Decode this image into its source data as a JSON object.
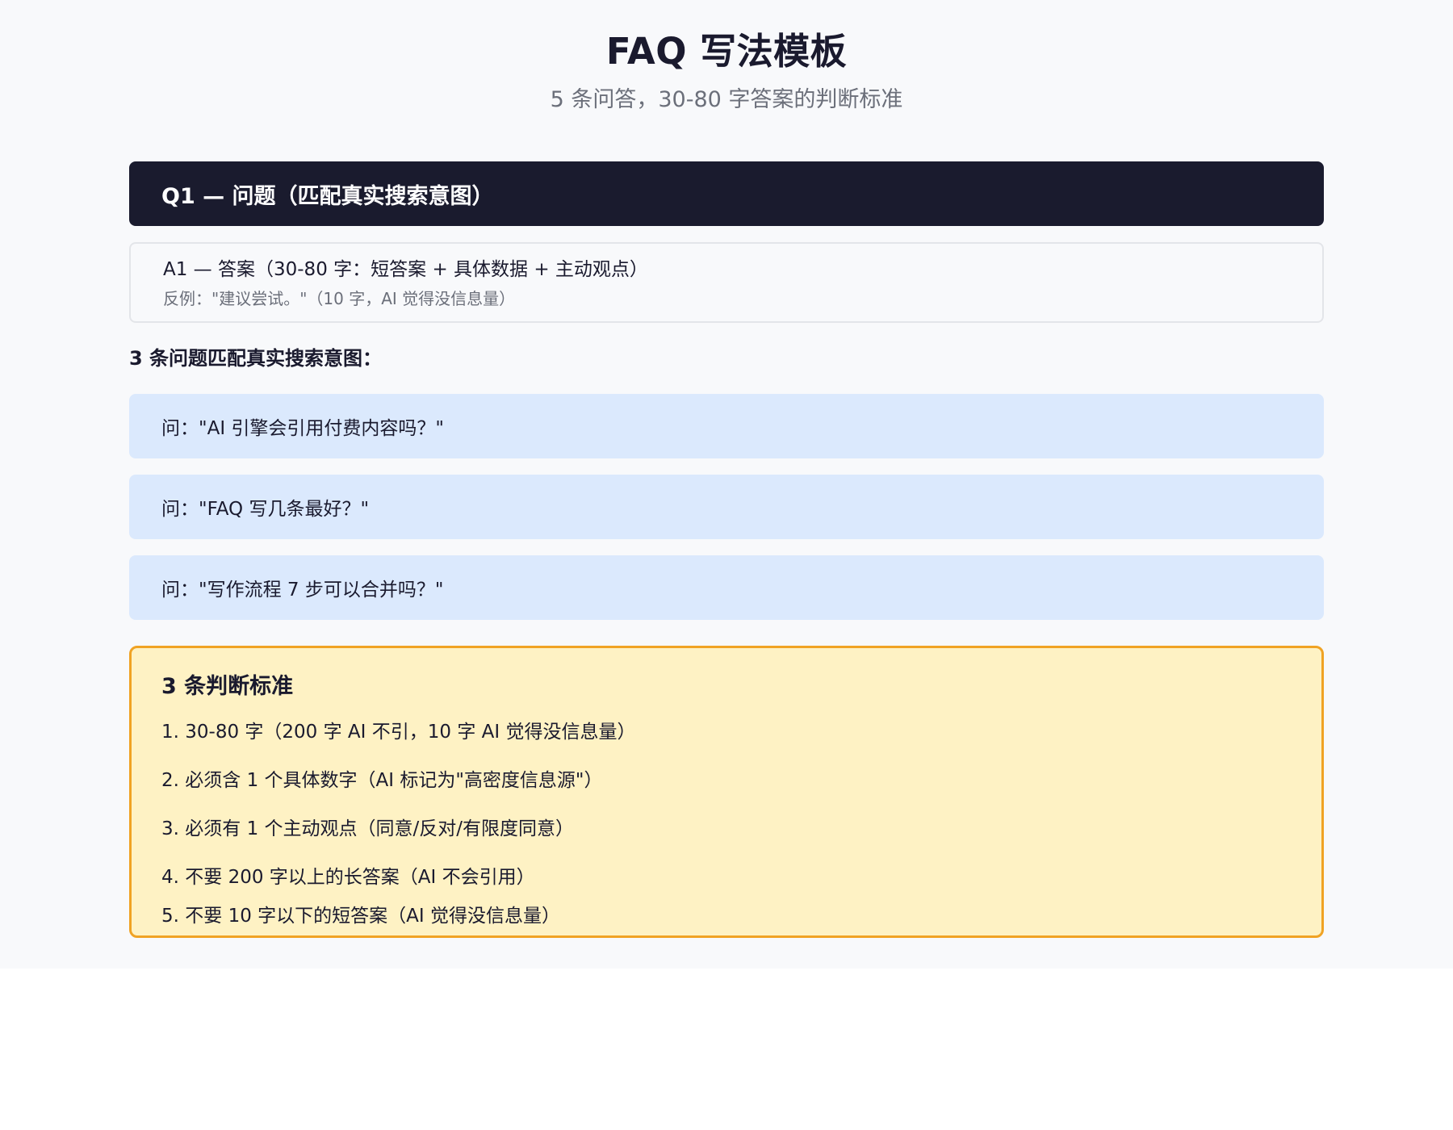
{
  "header": {
    "title": "FAQ 写法模板",
    "subtitle": "5 条问答，30-80 字答案的判断标准"
  },
  "q1": {
    "label": "Q1 — 问题（匹配真实搜索意图）"
  },
  "a1": {
    "label": "A1 — 答案（30-80 字：短答案 + 具体数据 + 主动观点）",
    "counterexample": "反例：\"建议尝试。\"（10 字，AI 觉得没信息量）"
  },
  "questions_section": {
    "heading": "3 条问题匹配真实搜索意图：",
    "items": [
      "问：\"AI 引擎会引用付费内容吗？\"",
      "问：\"FAQ 写几条最好？\"",
      "问：\"写作流程 7 步可以合并吗？\""
    ]
  },
  "criteria": {
    "title": "3 条判断标准",
    "items": [
      "1. 30-80 字（200 字 AI 不引，10 字 AI 觉得没信息量）",
      "2. 必须含 1 个具体数字（AI 标记为\"高密度信息源\"）",
      "3. 必须有 1 个主动观点（同意/反对/有限度同意）",
      "4. 不要 200 字以上的长答案（AI 不会引用）",
      "5. 不要 10 字以下的短答案（AI 觉得没信息量）"
    ]
  },
  "colors": {
    "page_bg": "#f8f9fb",
    "question_bar": "#1a1b2e",
    "question_item_bg": "#dbe9fd",
    "criteria_bg": "#fef2c4",
    "criteria_border": "#f0a324"
  }
}
